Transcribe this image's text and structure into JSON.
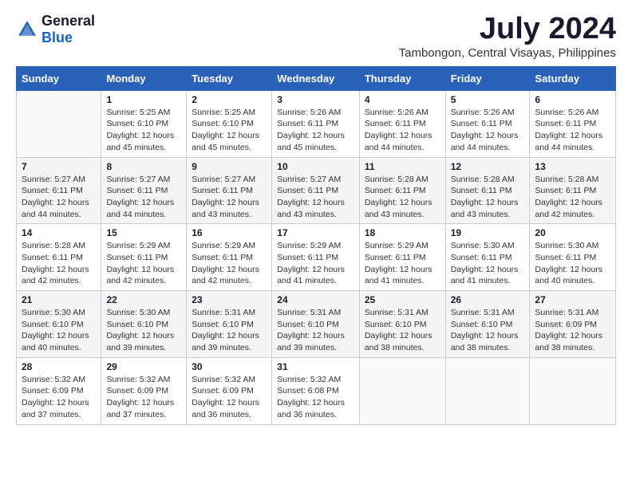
{
  "logo": {
    "general": "General",
    "blue": "Blue"
  },
  "title": "July 2024",
  "location": "Tambongon, Central Visayas, Philippines",
  "days_header": [
    "Sunday",
    "Monday",
    "Tuesday",
    "Wednesday",
    "Thursday",
    "Friday",
    "Saturday"
  ],
  "weeks": [
    [
      {
        "num": "",
        "info": ""
      },
      {
        "num": "1",
        "info": "Sunrise: 5:25 AM\nSunset: 6:10 PM\nDaylight: 12 hours\nand 45 minutes."
      },
      {
        "num": "2",
        "info": "Sunrise: 5:25 AM\nSunset: 6:10 PM\nDaylight: 12 hours\nand 45 minutes."
      },
      {
        "num": "3",
        "info": "Sunrise: 5:26 AM\nSunset: 6:11 PM\nDaylight: 12 hours\nand 45 minutes."
      },
      {
        "num": "4",
        "info": "Sunrise: 5:26 AM\nSunset: 6:11 PM\nDaylight: 12 hours\nand 44 minutes."
      },
      {
        "num": "5",
        "info": "Sunrise: 5:26 AM\nSunset: 6:11 PM\nDaylight: 12 hours\nand 44 minutes."
      },
      {
        "num": "6",
        "info": "Sunrise: 5:26 AM\nSunset: 6:11 PM\nDaylight: 12 hours\nand 44 minutes."
      }
    ],
    [
      {
        "num": "7",
        "info": "Sunrise: 5:27 AM\nSunset: 6:11 PM\nDaylight: 12 hours\nand 44 minutes."
      },
      {
        "num": "8",
        "info": "Sunrise: 5:27 AM\nSunset: 6:11 PM\nDaylight: 12 hours\nand 44 minutes."
      },
      {
        "num": "9",
        "info": "Sunrise: 5:27 AM\nSunset: 6:11 PM\nDaylight: 12 hours\nand 43 minutes."
      },
      {
        "num": "10",
        "info": "Sunrise: 5:27 AM\nSunset: 6:11 PM\nDaylight: 12 hours\nand 43 minutes."
      },
      {
        "num": "11",
        "info": "Sunrise: 5:28 AM\nSunset: 6:11 PM\nDaylight: 12 hours\nand 43 minutes."
      },
      {
        "num": "12",
        "info": "Sunrise: 5:28 AM\nSunset: 6:11 PM\nDaylight: 12 hours\nand 43 minutes."
      },
      {
        "num": "13",
        "info": "Sunrise: 5:28 AM\nSunset: 6:11 PM\nDaylight: 12 hours\nand 42 minutes."
      }
    ],
    [
      {
        "num": "14",
        "info": "Sunrise: 5:28 AM\nSunset: 6:11 PM\nDaylight: 12 hours\nand 42 minutes."
      },
      {
        "num": "15",
        "info": "Sunrise: 5:29 AM\nSunset: 6:11 PM\nDaylight: 12 hours\nand 42 minutes."
      },
      {
        "num": "16",
        "info": "Sunrise: 5:29 AM\nSunset: 6:11 PM\nDaylight: 12 hours\nand 42 minutes."
      },
      {
        "num": "17",
        "info": "Sunrise: 5:29 AM\nSunset: 6:11 PM\nDaylight: 12 hours\nand 41 minutes."
      },
      {
        "num": "18",
        "info": "Sunrise: 5:29 AM\nSunset: 6:11 PM\nDaylight: 12 hours\nand 41 minutes."
      },
      {
        "num": "19",
        "info": "Sunrise: 5:30 AM\nSunset: 6:11 PM\nDaylight: 12 hours\nand 41 minutes."
      },
      {
        "num": "20",
        "info": "Sunrise: 5:30 AM\nSunset: 6:11 PM\nDaylight: 12 hours\nand 40 minutes."
      }
    ],
    [
      {
        "num": "21",
        "info": "Sunrise: 5:30 AM\nSunset: 6:10 PM\nDaylight: 12 hours\nand 40 minutes."
      },
      {
        "num": "22",
        "info": "Sunrise: 5:30 AM\nSunset: 6:10 PM\nDaylight: 12 hours\nand 39 minutes."
      },
      {
        "num": "23",
        "info": "Sunrise: 5:31 AM\nSunset: 6:10 PM\nDaylight: 12 hours\nand 39 minutes."
      },
      {
        "num": "24",
        "info": "Sunrise: 5:31 AM\nSunset: 6:10 PM\nDaylight: 12 hours\nand 39 minutes."
      },
      {
        "num": "25",
        "info": "Sunrise: 5:31 AM\nSunset: 6:10 PM\nDaylight: 12 hours\nand 38 minutes."
      },
      {
        "num": "26",
        "info": "Sunrise: 5:31 AM\nSunset: 6:10 PM\nDaylight: 12 hours\nand 38 minutes."
      },
      {
        "num": "27",
        "info": "Sunrise: 5:31 AM\nSunset: 6:09 PM\nDaylight: 12 hours\nand 38 minutes."
      }
    ],
    [
      {
        "num": "28",
        "info": "Sunrise: 5:32 AM\nSunset: 6:09 PM\nDaylight: 12 hours\nand 37 minutes."
      },
      {
        "num": "29",
        "info": "Sunrise: 5:32 AM\nSunset: 6:09 PM\nDaylight: 12 hours\nand 37 minutes."
      },
      {
        "num": "30",
        "info": "Sunrise: 5:32 AM\nSunset: 6:09 PM\nDaylight: 12 hours\nand 36 minutes."
      },
      {
        "num": "31",
        "info": "Sunrise: 5:32 AM\nSunset: 6:08 PM\nDaylight: 12 hours\nand 36 minutes."
      },
      {
        "num": "",
        "info": ""
      },
      {
        "num": "",
        "info": ""
      },
      {
        "num": "",
        "info": ""
      }
    ]
  ]
}
